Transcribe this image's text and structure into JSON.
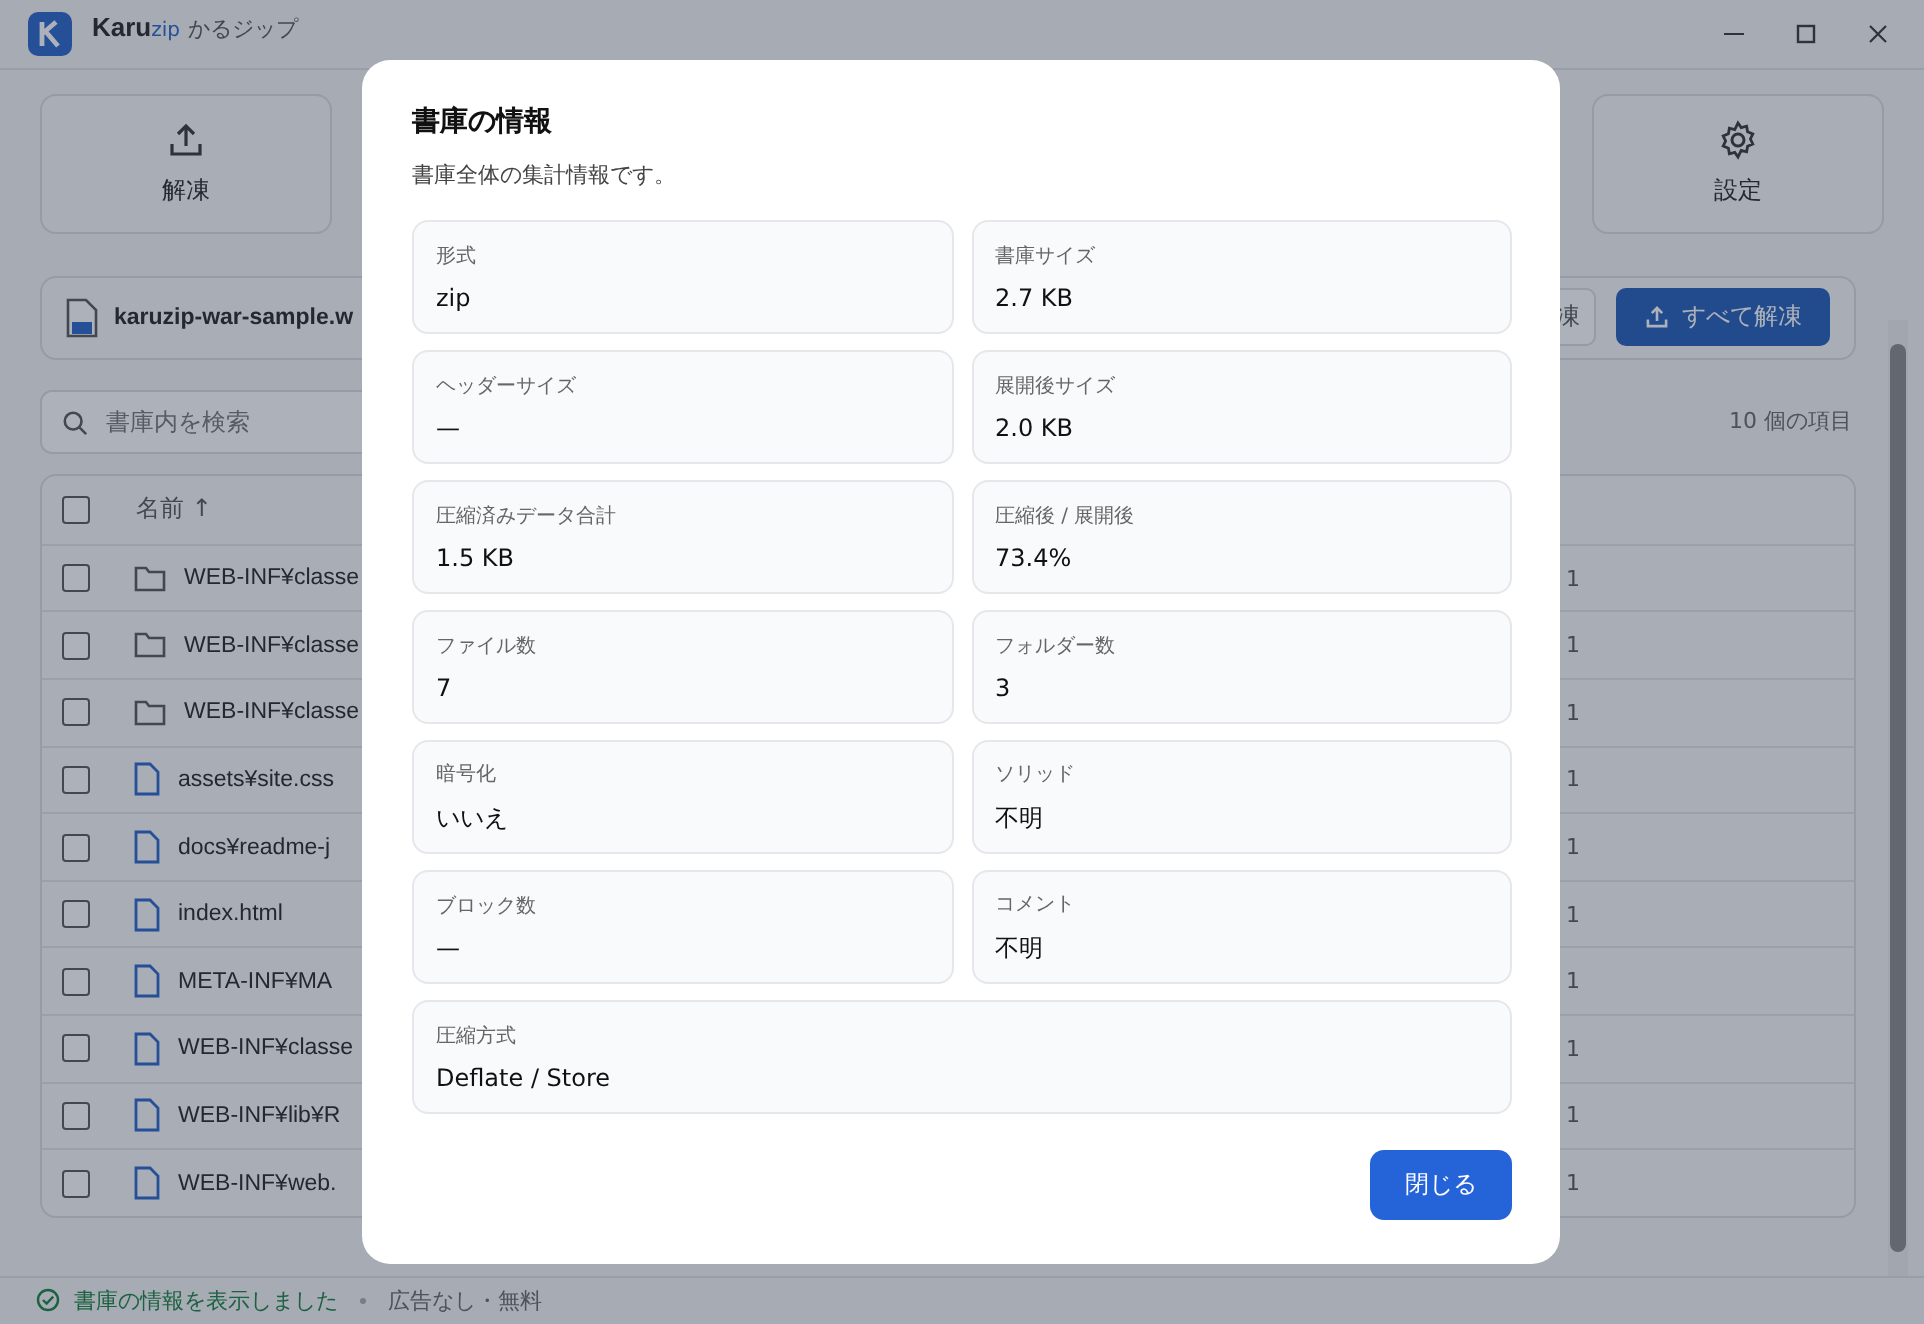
{
  "window": {
    "app_name": "Karu",
    "app_suffix": "zip",
    "app_subtitle": "かるジップ"
  },
  "toolbar": [
    {
      "label": "解凍"
    },
    {
      "label": "設定"
    }
  ],
  "archive_bar": {
    "file_name": "karuzip-war-sample.w",
    "buttons": [
      {
        "label": "凍",
        "kind": "secondary"
      },
      {
        "label": "すべて解凍",
        "kind": "primary"
      }
    ]
  },
  "search": {
    "placeholder": "書庫内を検索"
  },
  "item_count": "10 個の項目",
  "table": {
    "select_all_checked": false,
    "columns": [
      {
        "label": "名前 ↑"
      }
    ],
    "rows": [
      {
        "kind": "folder",
        "name": "WEB-INF¥classe",
        "column_2": "1",
        "checked": false
      },
      {
        "kind": "folder",
        "name": "WEB-INF¥classe",
        "column_2": "1",
        "checked": false
      },
      {
        "kind": "folder",
        "name": "WEB-INF¥classe",
        "column_2": "1",
        "checked": false
      },
      {
        "kind": "file",
        "name": "assets¥site.css",
        "column_2": "1",
        "checked": false
      },
      {
        "kind": "file",
        "name": "docs¥readme-j",
        "column_2": "1",
        "checked": false
      },
      {
        "kind": "file",
        "name": "index.html",
        "column_2": "1",
        "checked": false
      },
      {
        "kind": "file",
        "name": "META-INF¥MA",
        "column_2": "1",
        "checked": false
      },
      {
        "kind": "file",
        "name": "WEB-INF¥classe",
        "column_2": "1",
        "checked": false
      },
      {
        "kind": "file",
        "name": "WEB-INF¥lib¥R",
        "column_2": "1",
        "checked": false
      },
      {
        "kind": "file",
        "name": "WEB-INF¥web.",
        "column_2": "1",
        "checked": false
      }
    ]
  },
  "dialog": {
    "title": "書庫の情報",
    "subtitle": "書庫全体の集計情報です。",
    "fields": [
      {
        "label": "形式",
        "value": "zip",
        "wide": false
      },
      {
        "label": "書庫サイズ",
        "value": "2.7 KB",
        "wide": false
      },
      {
        "label": "ヘッダーサイズ",
        "value": "—",
        "wide": false
      },
      {
        "label": "展開後サイズ",
        "value": "2.0 KB",
        "wide": false
      },
      {
        "label": "圧縮済みデータ合計",
        "value": "1.5 KB",
        "wide": false
      },
      {
        "label": "圧縮後 / 展開後",
        "value": "73.4%",
        "wide": false
      },
      {
        "label": "ファイル数",
        "value": "7",
        "wide": false
      },
      {
        "label": "フォルダー数",
        "value": "3",
        "wide": false
      },
      {
        "label": "暗号化",
        "value": "いいえ",
        "wide": false
      },
      {
        "label": "ソリッド",
        "value": "不明",
        "wide": false
      },
      {
        "label": "ブロック数",
        "value": "—",
        "wide": false
      },
      {
        "label": "コメント",
        "value": "不明",
        "wide": false
      },
      {
        "label": "圧縮方式",
        "value": "Deflate / Store",
        "wide": true
      }
    ],
    "close_button": "閉じる"
  },
  "status_bar": {
    "message": "書庫の情報を表示しました",
    "note": "広告なし・無料"
  }
}
